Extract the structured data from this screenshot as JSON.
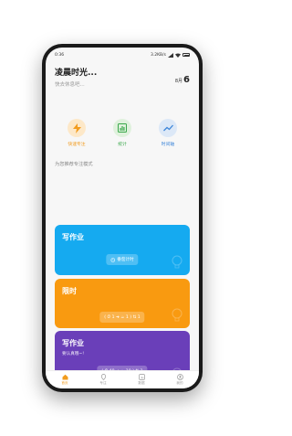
{
  "status_bar": {
    "time": "0:36",
    "net_speed": "3.2KB/s"
  },
  "header": {
    "greeting": "凌晨时光...",
    "subgreeting": "快去休息吧...",
    "date_month": "8月",
    "date_day": "6"
  },
  "quick_actions": [
    {
      "label": "快速专注",
      "icon": "lightning-icon"
    },
    {
      "label": "统计",
      "icon": "chart-icon"
    },
    {
      "label": "时间轴",
      "icon": "trend-icon"
    }
  ],
  "section_title": "为您推荐专注模式",
  "cards": [
    {
      "title": "写作业",
      "subtitle": "",
      "pill": "番茄计时",
      "color": "#15aaf0"
    },
    {
      "title": "限时",
      "subtitle": "",
      "pill": "( ⏱ 1 ➜ ☕ 1 ) ⇅ 1",
      "color": "#f99a10"
    },
    {
      "title": "写作业",
      "subtitle": "要认真哦~!",
      "pill": "( ⏱ 40 ➜ ☕ 10 ) ⇅ 1",
      "color": "#6a3fb9"
    }
  ],
  "tabbar": [
    {
      "label": "首页",
      "icon": "home-icon",
      "active": true
    },
    {
      "label": "专注",
      "icon": "location-icon",
      "active": false
    },
    {
      "label": "数据",
      "icon": "data-icon",
      "active": false
    },
    {
      "label": "我的",
      "icon": "user-icon",
      "active": false
    }
  ]
}
